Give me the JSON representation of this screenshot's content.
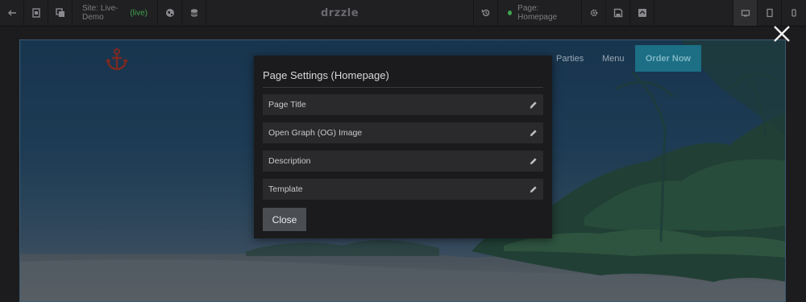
{
  "toolbar": {
    "site_prefix": "Site: Live-Demo",
    "site_status": "(live)",
    "brand": "drzzle",
    "page_label": "Page: Homepage",
    "colors": {
      "live_green": "#3fa34d",
      "bg": "#202022"
    }
  },
  "site_preview": {
    "nav_links": [
      "Parties",
      "Menu"
    ],
    "order_button": "Order Now",
    "accent": "#1c6f84"
  },
  "modal": {
    "title": "Page Settings (Homepage)",
    "settings": [
      {
        "label": "Page Title",
        "icon": "pencil-icon"
      },
      {
        "label": "Open Graph (OG) Image",
        "icon": "pencil-icon"
      },
      {
        "label": "Description",
        "icon": "pencil-icon"
      },
      {
        "label": "Template",
        "icon": "pencil-icon"
      }
    ],
    "close_button": "Close"
  }
}
